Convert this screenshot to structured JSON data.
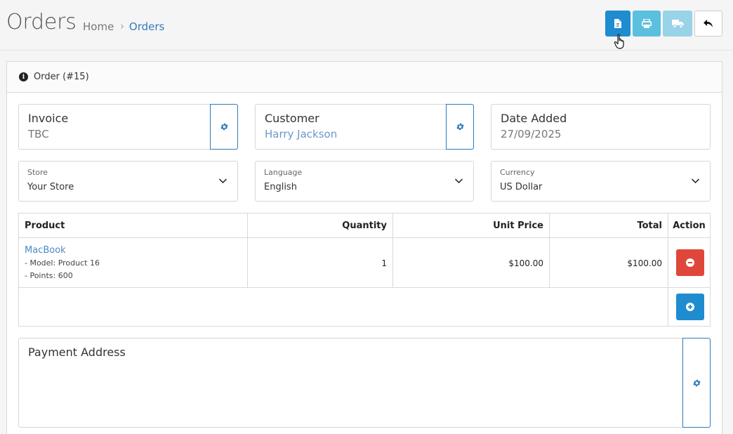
{
  "header": {
    "title": "Orders",
    "breadcrumb": {
      "home": "Home",
      "separator": "›",
      "current": "Orders"
    },
    "buttons": {
      "invoice_icon": "invoice-icon",
      "print_icon": "print-icon",
      "shipping_icon": "truck-icon",
      "back_icon": "reply-icon"
    }
  },
  "panel": {
    "title": "Order (#15)"
  },
  "cards": {
    "invoice": {
      "label": "Invoice",
      "value": "TBC"
    },
    "customer": {
      "label": "Customer",
      "value": "Harry Jackson"
    },
    "date_added": {
      "label": "Date Added",
      "value": "27/09/2025"
    }
  },
  "selects": {
    "store": {
      "label": "Store",
      "value": "Your Store"
    },
    "language": {
      "label": "Language",
      "value": "English"
    },
    "currency": {
      "label": "Currency",
      "value": "US Dollar"
    }
  },
  "table": {
    "headers": {
      "product": "Product",
      "quantity": "Quantity",
      "unit_price": "Unit Price",
      "total": "Total",
      "action": "Action"
    },
    "rows": [
      {
        "product": "MacBook",
        "model": "- Model: Product 16",
        "points": "- Points: 600",
        "quantity": "1",
        "unit_price": "$100.00",
        "total": "$100.00"
      }
    ]
  },
  "payment": {
    "label": "Payment Address"
  },
  "colors": {
    "primary": "#1f8ccf",
    "info": "#5bc0de",
    "danger": "#e0473b",
    "link": "#4a8ac4"
  }
}
